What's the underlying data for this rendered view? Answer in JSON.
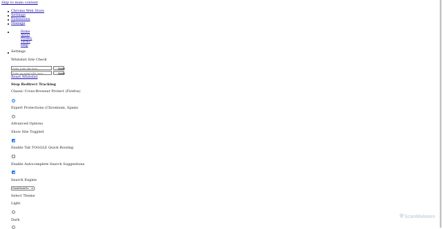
{
  "header": {
    "link": "Skip to main content"
  },
  "nav": {
    "items": [
      "Chrome Web Store",
      "Settings",
      "Extensions",
      "Manage"
    ],
    "subitems": [
      "Home",
      "About",
      "Privacy",
      "Terms",
      "Help"
    ],
    "settings_label": "Settings"
  },
  "sections": {
    "whitelist_heading": "Whitelist Site Check",
    "tab_placeholder": "Enter a tab title here...",
    "url_placeholder": "Enter an exact URL here...",
    "apply_label": "Apply",
    "reset_link": "Reset Whitelist",
    "redirect_heading": "Stop Redirect Tracking",
    "option_blocker": "Classic Cross-Browser Protect (Firefox)",
    "option_exit": "Expert Protections (Chromium, Spam)",
    "advanced_heading": "Advanced Options",
    "show_toggle_heading": "Show Site Toggled",
    "enable_toggle": "Enable Tab TOGGLE Quick Routing",
    "autocomplete": "Enable Autocomplete Search Suggestions",
    "search_engine_heading": "Search Engine",
    "search_engine_value": "DuckDuckGo",
    "theme_heading": "Select Theme",
    "theme_light": "Light",
    "theme_dark": "Dark"
  },
  "watermark": {
    "text": "ScanMalware",
    "icon": "scanmalware-logo-icon"
  },
  "colors": {
    "link": "#1a0dab",
    "accent": "#1a73e8",
    "watermark": "#c8d4e0"
  }
}
